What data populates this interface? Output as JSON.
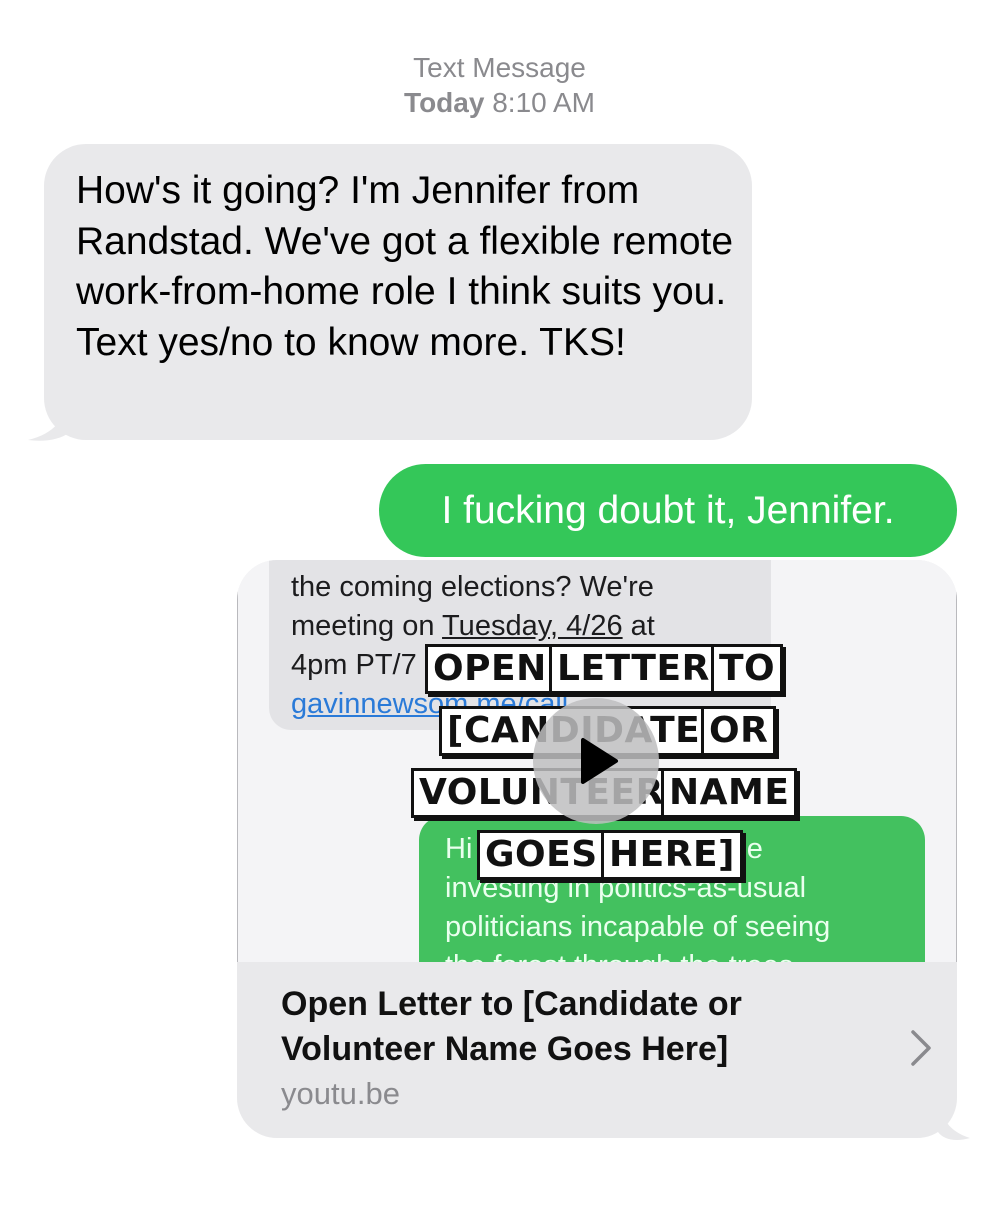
{
  "header": {
    "service_label": "Text Message",
    "day_label": "Today",
    "time_label": "8:10 AM"
  },
  "messages": {
    "received_text": "How's it going? I'm Jennifer from Randstad. We've got a flexible remote work-from-home role I think suits you. Text yes/no to know more. TKS!",
    "sent_text": "I fucking doubt it, Jennifer."
  },
  "link_preview": {
    "thumbnail": {
      "screenshot_in_lines": [
        "the coming elections? We're",
        "meeting on",
        "Tuesday, 4/26",
        "at",
        "4pm PT/7",
        "gavinnewsom.me/call"
      ],
      "screenshot_out_lines": [
        "Hi",
        "done",
        "investing in politics-as-usual",
        "politicians incapable of seeing",
        "the forest through the trees"
      ],
      "overlay_words": [
        "OPEN",
        "LETTER",
        "TO",
        "[CANDIDATE",
        "OR",
        "VOLUNTEER",
        "NAME",
        "GOES",
        "HERE]"
      ]
    },
    "title": "Open Letter to [Candidate or Volunteer Name Goes Here]",
    "domain": "youtu.be"
  },
  "colors": {
    "received_bubble": "#e9e9eb",
    "sent_bubble": "#34c759",
    "meta_text": "#8a8a8e"
  },
  "icons": {
    "play": "play-icon",
    "chevron": "chevron-right-icon"
  }
}
